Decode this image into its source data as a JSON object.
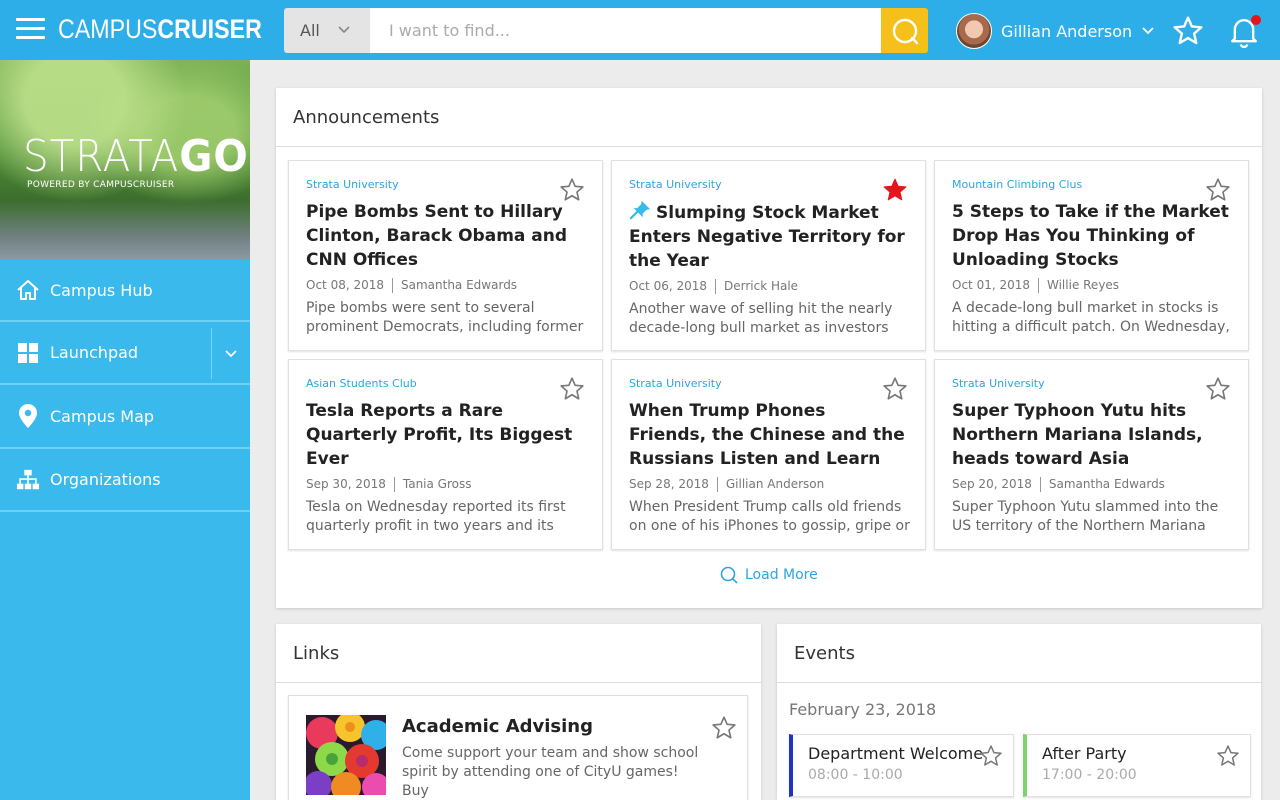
{
  "header": {
    "brand_regular": "CAMPUS",
    "brand_bold": "CRUISER",
    "search_filter": "All",
    "search_placeholder": "I want to find...",
    "user_name": "Gillian Anderson",
    "has_notifications": true
  },
  "sidebar": {
    "logo_thin": "STRATA",
    "logo_bold": "GO",
    "logo_sub": "POWERED BY CAMPUSCRUISER",
    "items": [
      {
        "label": "Campus Hub",
        "icon": "home-icon"
      },
      {
        "label": "Launchpad",
        "icon": "grid-icon",
        "has_dropdown": true
      },
      {
        "label": "Campus Map",
        "icon": "map-pin-icon"
      },
      {
        "label": "Organizations",
        "icon": "org-chart-icon"
      }
    ]
  },
  "announcements": {
    "title": "Announcements",
    "load_more": "Load More",
    "cards": [
      {
        "source": "Strata University",
        "title": "Pipe Bombs Sent to Hillary Clinton, Barack Obama and CNN Offices",
        "date": "Oct 08, 2018",
        "author": "Samantha Edwards",
        "excerpt": "Pipe bombs were sent to several prominent Democrats, including former",
        "starred": false,
        "pinned": false
      },
      {
        "source": "Strata University",
        "title": "Slumping Stock Market Enters Negative Territory for the Year",
        "date": "Oct 06, 2018",
        "author": "Derrick Hale",
        "excerpt": "Another wave of selling hit the nearly decade-long bull market as investors",
        "starred": true,
        "pinned": true
      },
      {
        "source": "Mountain Climbing Clus",
        "title": "5 Steps to Take if the Market Drop Has You Thinking of Unloading Stocks",
        "date": "Oct 01, 2018",
        "author": "Willie Reyes",
        "excerpt": "A decade-long bull market in stocks is hitting a difficult patch. On Wednesday,",
        "starred": false,
        "pinned": false
      },
      {
        "source": "Asian Students Club",
        "title": "Tesla Reports a Rare Quarterly Profit, Its Biggest Ever",
        "date": "Sep 30, 2018",
        "author": "Tania Gross",
        "excerpt": "Tesla on Wednesday reported its first quarterly profit in two years and its",
        "starred": false,
        "pinned": false
      },
      {
        "source": "Strata University",
        "title": "When Trump Phones Friends, the Chinese and the Russians Listen and Learn",
        "date": "Sep 28, 2018",
        "author": "Gillian Anderson",
        "excerpt": "When President Trump calls old friends on one of his iPhones to gossip, gripe or",
        "starred": false,
        "pinned": false
      },
      {
        "source": "Strata University",
        "title": "Super Typhoon Yutu hits Northern Mariana Islands, heads toward Asia",
        "date": "Sep 20, 2018",
        "author": "Samantha Edwards",
        "excerpt": "Super Typhoon Yutu slammed into the US territory of the Northern Mariana Islands",
        "starred": false,
        "pinned": false
      }
    ]
  },
  "links": {
    "title": "Links",
    "items": [
      {
        "title": "Academic Advising",
        "description": "Come support your team and show school spirit by attending one of CityU games! Buy",
        "starred": false
      }
    ]
  },
  "events": {
    "title": "Events",
    "date": "February 23, 2018",
    "items": [
      {
        "title": "Department Welcome",
        "time": "08:00 - 10:00",
        "color": "#1f35c2",
        "starred": false
      },
      {
        "title": "After Party",
        "time": "17:00 - 20:00",
        "color": "#7ed36a",
        "starred": false
      }
    ]
  },
  "colors": {
    "topbar": "#2eaee8",
    "sidebar": "#39b9ec",
    "search_button": "#f6c01a",
    "accent_link": "#2aa6e0",
    "star_active": "#e8141b",
    "pin": "#39b9ec"
  }
}
